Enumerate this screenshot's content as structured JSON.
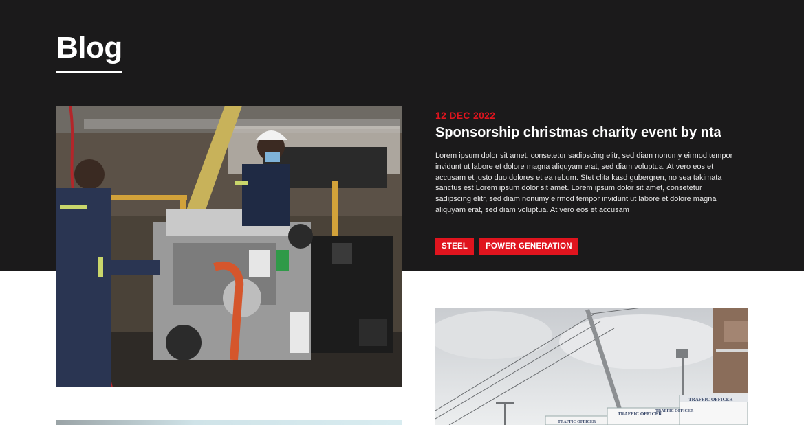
{
  "page": {
    "title": "Blog"
  },
  "featured_post": {
    "date": "12 DEC 2022",
    "title": "Sponsorship christmas charity event by nta",
    "excerpt": "Lorem ipsum dolor sit amet, consetetur sadipscing elitr, sed diam nonumy eirmod tempor invidunt ut labore et dolore magna aliquyam erat, sed diam voluptua. At vero eos et accusam et justo duo dolores et ea rebum. Stet clita kasd gubergren, no sea takimata sanctus est Lorem ipsum dolor sit amet. Lorem ipsum dolor sit amet, consetetur sadipscing elitr, sed diam nonumy eirmod tempor invidunt ut labore et dolore magna aliquyam erat, sed diam voluptua. At vero eos et accusam",
    "tags": [
      "STEEL",
      "POWER GENERATION"
    ],
    "image_icon": "engine-workshop-photo"
  },
  "second_post": {
    "image_icon": "traffic-office-street-photo",
    "signs": [
      "TRAFFIC OFFICER",
      "TRAFFIC OFFICER",
      "TRAFFIC OFFICER",
      "TRAFFIC OFFICER"
    ]
  },
  "colors": {
    "dark_band": "#1b1a1b",
    "accent": "#e0141e",
    "text_light": "#ffffff"
  }
}
